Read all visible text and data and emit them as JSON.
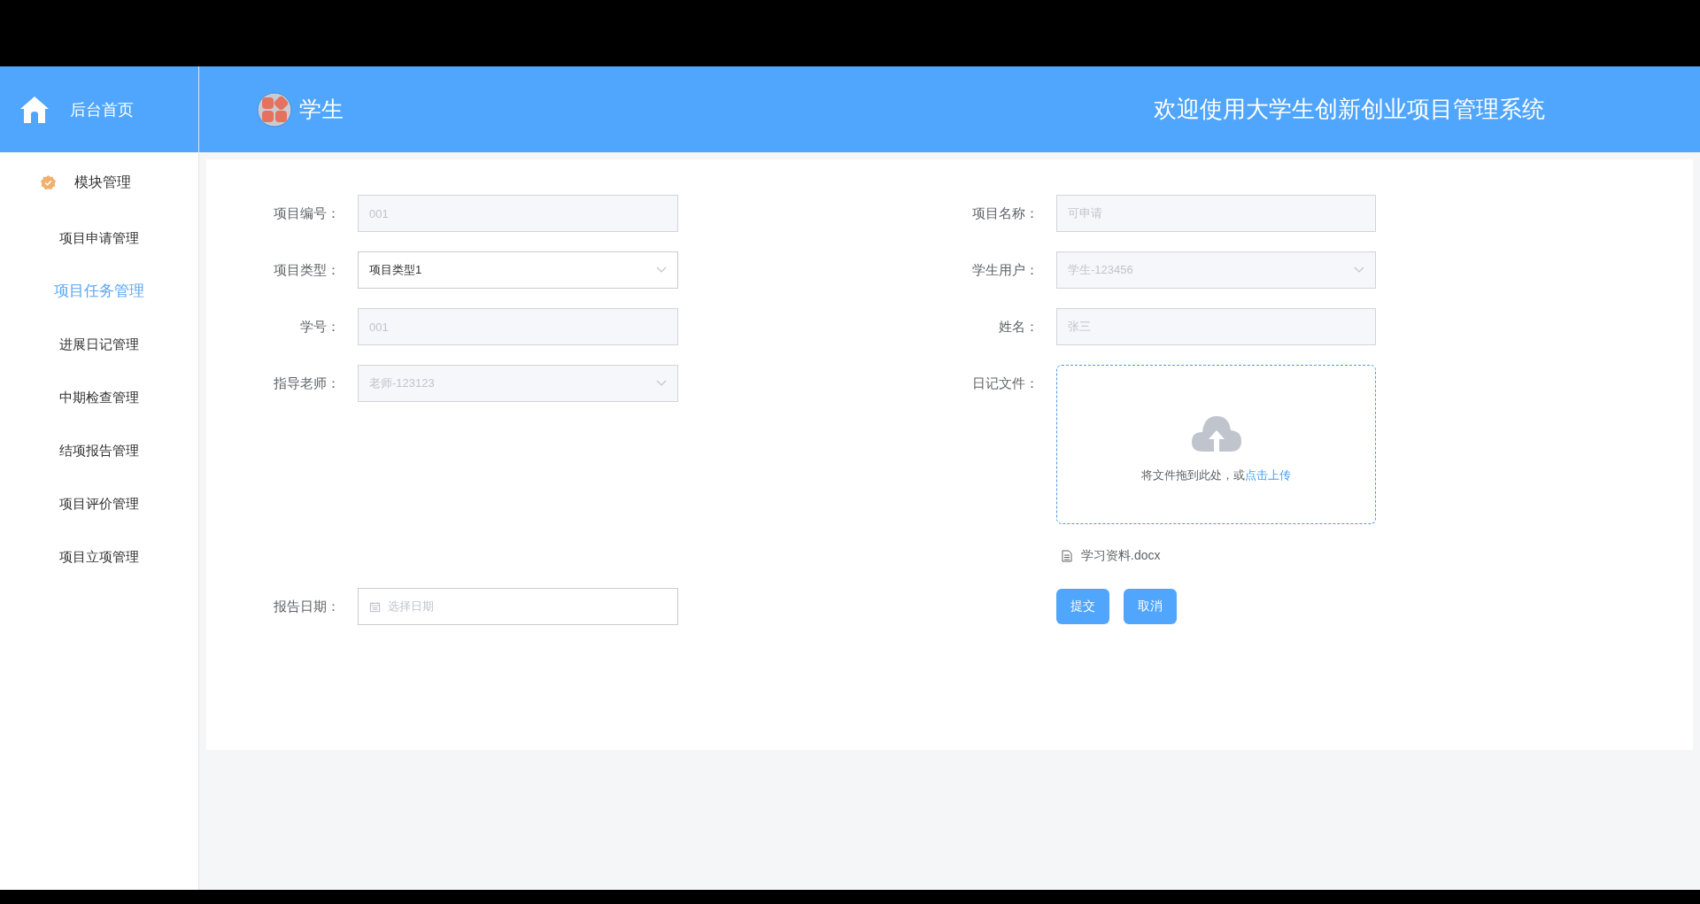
{
  "header": {
    "home_label": "后台首页",
    "role": "学生",
    "title": "欢迎使用大学生创新创业项目管理系统"
  },
  "sidebar": {
    "heading": "模块管理",
    "items": [
      {
        "label": "项目申请管理",
        "selected": false
      },
      {
        "label": "项目任务管理",
        "selected": true
      },
      {
        "label": "进展日记管理",
        "selected": false
      },
      {
        "label": "中期检查管理",
        "selected": false
      },
      {
        "label": "结项报告管理",
        "selected": false
      },
      {
        "label": "项目评价管理",
        "selected": false
      },
      {
        "label": "项目立项管理",
        "selected": false
      }
    ]
  },
  "form": {
    "left_fields": [
      {
        "label": "项目编号：",
        "kind": "input",
        "value": "001",
        "disabled": true
      },
      {
        "label": "项目类型：",
        "kind": "select",
        "value": "项目类型1",
        "disabled": false
      },
      {
        "label": "学号：",
        "kind": "input",
        "value": "001",
        "disabled": true
      },
      {
        "label": "指导老师：",
        "kind": "select",
        "value": "老师-123123",
        "disabled": true
      },
      {
        "label": "报告日期：",
        "kind": "date",
        "placeholder": "选择日期"
      }
    ],
    "right_fields": [
      {
        "label": "项目名称：",
        "kind": "input",
        "value": "可申请",
        "disabled": true
      },
      {
        "label": "学生用户：",
        "kind": "select",
        "value": "学生-123456",
        "disabled": true
      },
      {
        "label": "姓名：",
        "kind": "input",
        "value": "张三",
        "disabled": true
      }
    ],
    "upload": {
      "label": "日记文件：",
      "hint": "将文件拖到此处，或",
      "link": "点击上传",
      "files": [
        "学习资料.docx"
      ]
    },
    "buttons": [
      "提交",
      "取消"
    ]
  }
}
